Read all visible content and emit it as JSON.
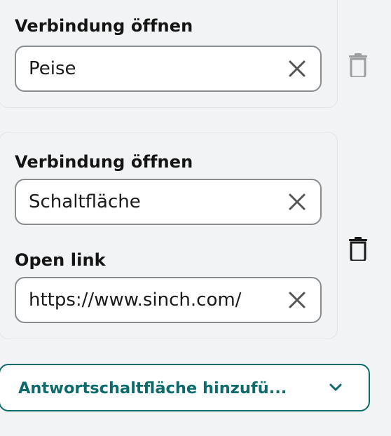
{
  "cards": [
    {
      "label": "Verbindung öffnen",
      "field_value": "Peise"
    },
    {
      "label": "Verbindung öffnen",
      "field_value": "Schaltfläche",
      "link_label": "Open link",
      "link_value": "https://www.sinch.com/"
    }
  ],
  "add_button": {
    "label": "Antwortschaltfläche hinzufü..."
  },
  "icons": {
    "clear": "close-icon",
    "delete": "trash-icon",
    "expand": "chevron-down-icon"
  },
  "colors": {
    "accent": "#0e6b6b",
    "background": "#f2f3f4",
    "field_border": "#8a8d90"
  }
}
